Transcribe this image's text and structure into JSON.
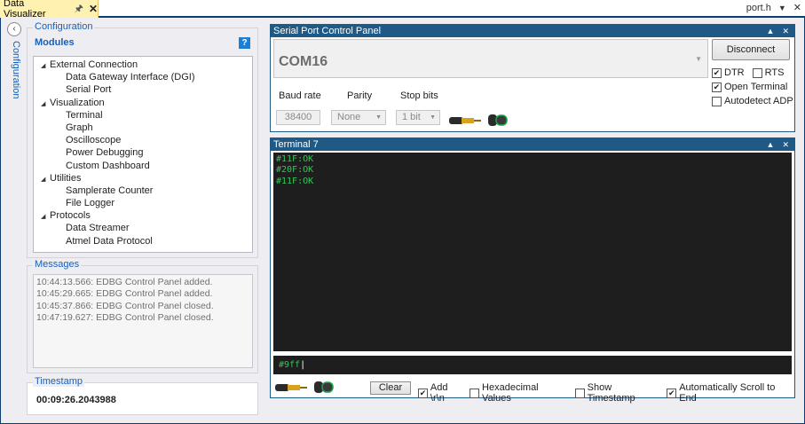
{
  "window": {
    "tab_title": "Data Visualizer",
    "pin_icon": "pin-icon",
    "close_icon": "close-icon",
    "right_tab_title": "port.h"
  },
  "sidebar": {
    "collapse_icon": "chevron-left-icon",
    "label": "Configuration"
  },
  "configuration": {
    "group_title": "Configuration",
    "modules_label": "Modules",
    "help_label": "?",
    "tree": [
      {
        "label": "External Connection",
        "level": 0
      },
      {
        "label": "Data Gateway Interface (DGI)",
        "level": 1
      },
      {
        "label": "Serial Port",
        "level": 1
      },
      {
        "label": "Visualization",
        "level": 0
      },
      {
        "label": "Terminal",
        "level": 1
      },
      {
        "label": "Graph",
        "level": 1
      },
      {
        "label": "Oscilloscope",
        "level": 1
      },
      {
        "label": "Power Debugging",
        "level": 1
      },
      {
        "label": "Custom Dashboard",
        "level": 1
      },
      {
        "label": "Utilities",
        "level": 0
      },
      {
        "label": "Samplerate Counter",
        "level": 1
      },
      {
        "label": "File Logger",
        "level": 1
      },
      {
        "label": "Protocols",
        "level": 0
      },
      {
        "label": "Data Streamer",
        "level": 1
      },
      {
        "label": "Atmel Data Protocol",
        "level": 1
      }
    ]
  },
  "messages": {
    "group_title": "Messages",
    "items": [
      "10:44:13.566: EDBG Control Panel added.",
      "10:45:29.665: EDBG Control Panel added.",
      "10:45:37.866: EDBG Control Panel closed.",
      "10:47:19.627: EDBG Control Panel closed."
    ]
  },
  "timestamp": {
    "group_title": "Timestamp",
    "value": "00:09:26.2043988"
  },
  "serial_panel": {
    "title": "Serial Port Control Panel",
    "port": "COM16",
    "disconnect_label": "Disconnect",
    "dtr_label": "DTR",
    "dtr_checked": true,
    "rts_label": "RTS",
    "rts_checked": false,
    "open_terminal_label": "Open Terminal",
    "open_terminal_checked": true,
    "autodetect_label": "Autodetect ADP",
    "autodetect_checked": false,
    "baud_label": "Baud rate",
    "baud_value": "38400",
    "parity_label": "Parity",
    "parity_value": "None",
    "stopbits_label": "Stop bits",
    "stopbits_value": "1 bit"
  },
  "terminal": {
    "title": "Terminal 7",
    "lines": [
      "#11F:OK",
      "#20F:OK",
      "#11F:OK"
    ],
    "input_value": "#9ff",
    "clear_label": "Clear",
    "add_crlf_label": "Add \\r\\n",
    "add_crlf_checked": true,
    "hex_label": "Hexadecimal Values",
    "hex_checked": false,
    "timestamp_label": "Show Timestamp",
    "timestamp_checked": false,
    "autoscroll_label": "Automatically Scroll to End",
    "autoscroll_checked": true
  },
  "colors": {
    "accent": "#1f5a87",
    "link": "#1a5fb4",
    "terminal_bg": "#1e1e1e",
    "terminal_text": "#39c35a",
    "tab_active": "#fff1b0"
  }
}
